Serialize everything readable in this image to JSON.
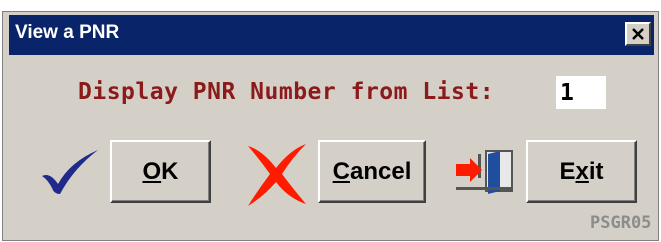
{
  "window": {
    "title": "View a PNR",
    "close_label": "×"
  },
  "form": {
    "prompt": "Display PNR Number from List:",
    "pnr_value": "1"
  },
  "buttons": {
    "ok": {
      "underline": "O",
      "rest": "K"
    },
    "cancel": {
      "underline": "C",
      "rest": "ancel"
    },
    "exit": {
      "pre": "E",
      "underline": "x",
      "rest": "it"
    }
  },
  "icons": {
    "ok": "checkmark-icon",
    "cancel": "red-x-icon",
    "exit": "exit-door-icon"
  },
  "screen_id": "PSGR05",
  "colors": {
    "titlebar": "#0a246a",
    "dialog": "#d4d0c8",
    "prompt_text": "#8b1a1a",
    "check": "#1f2a8a",
    "x_mark": "#ff1a00"
  }
}
